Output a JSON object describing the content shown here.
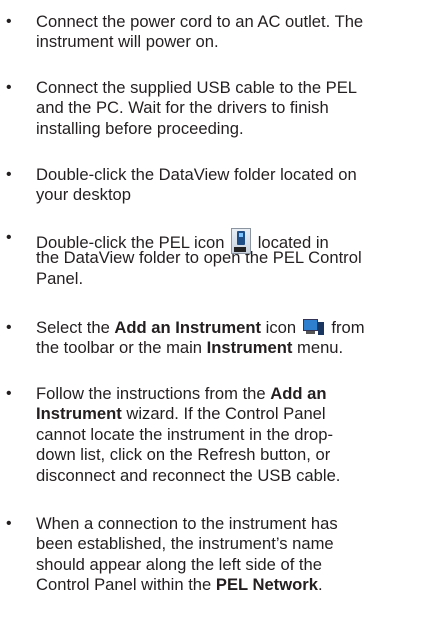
{
  "icons": {
    "pel_icon": "pel-icon",
    "add_instrument_icon": "add-instrument-icon"
  },
  "steps": [
    {
      "lines": [
        "Connect the power cord to an AC outlet. The",
        "instrument will power on."
      ]
    },
    {
      "lines": [
        "Connect the supplied USB cable to the PEL",
        "and the PC. Wait for the drivers to finish",
        "installing before proceeding."
      ]
    },
    {
      "lines": [
        "Double-click the DataView folder located on",
        "your desktop"
      ]
    },
    {
      "line1_a": "Double-click the PEL icon",
      "line1_b": "located in",
      "lines_rest": [
        "the DataView folder to open the PEL Control",
        "Panel."
      ]
    },
    {
      "line1_a": "Select the ",
      "line1_bold": "Add an Instrument",
      "line1_b": " icon",
      "line1_c": "from",
      "line2_a": "the toolbar or the main ",
      "line2_bold": "Instrument",
      "line2_b": " menu."
    },
    {
      "line1_a": "Follow the instructions from the ",
      "line1_bold": "Add an",
      "line2_bold": "Instrument",
      "line2_b": " wizard. If the Control Panel",
      "lines_rest": [
        "cannot locate the instrument in the drop-",
        "down list, click on the Refresh button, or",
        "disconnect and reconnect the USB cable."
      ]
    },
    {
      "lines": [
        "When a connection to the instrument has",
        "been established, the instrument’s name",
        "should appear along the left side of the"
      ],
      "last_a": "Control Panel within the ",
      "last_bold": "PEL Network",
      "last_b": "."
    }
  ]
}
